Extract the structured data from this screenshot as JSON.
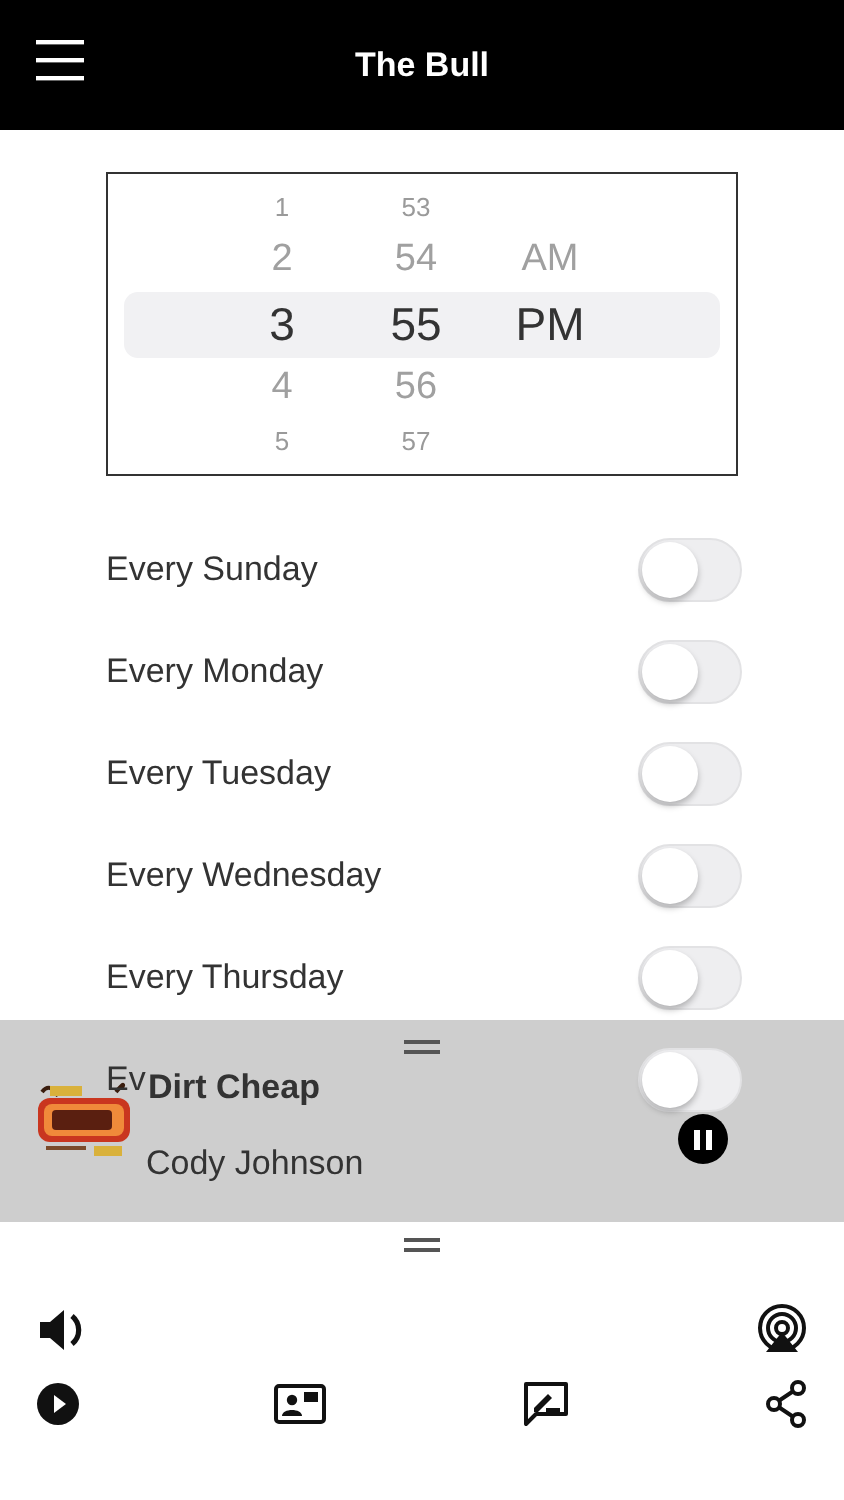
{
  "header": {
    "title": "The Bull"
  },
  "picker": {
    "columns": [
      {
        "items": [
          {
            "label": "1",
            "selected": false
          },
          {
            "label": "2",
            "selected": false
          },
          {
            "label": "3",
            "selected": true
          },
          {
            "label": "4",
            "selected": false
          },
          {
            "label": "5",
            "selected": false
          }
        ]
      },
      {
        "items": [
          {
            "label": "53",
            "selected": false
          },
          {
            "label": "54",
            "selected": false
          },
          {
            "label": "55",
            "selected": true
          },
          {
            "label": "56",
            "selected": false
          },
          {
            "label": "57",
            "selected": false
          }
        ]
      },
      {
        "items": [
          {
            "label": "AM",
            "selected": false
          },
          {
            "label": "PM",
            "selected": true
          }
        ]
      }
    ]
  },
  "repeat_days": [
    {
      "label": "Every Sunday",
      "on": false
    },
    {
      "label": "Every Monday",
      "on": false
    },
    {
      "label": "Every Tuesday",
      "on": false
    },
    {
      "label": "Every Wednesday",
      "on": false
    },
    {
      "label": "Every Thursday",
      "on": false
    },
    {
      "label": "Ev",
      "on": false
    }
  ],
  "now_playing": {
    "song": "Dirt Cheap",
    "artist": "Cody Johnson",
    "playing": true
  }
}
